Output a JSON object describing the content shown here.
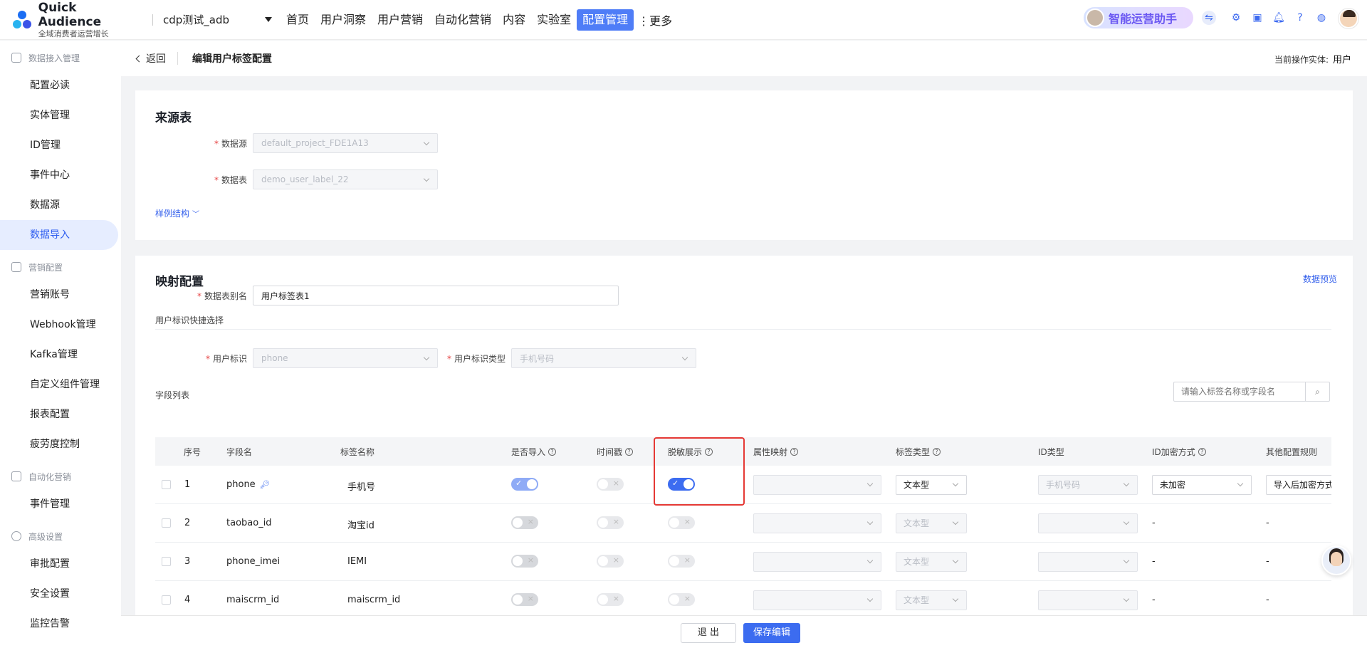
{
  "app": {
    "name": "Quick Audience",
    "slogan": "全域消费者运营增长",
    "project": "cdp测试_adb"
  },
  "nav": {
    "items": [
      "首页",
      "用户洞察",
      "用户营销",
      "自动化营销",
      "内容",
      "实验室",
      "配置管理"
    ],
    "active": "配置管理",
    "more": "更多"
  },
  "assistant": {
    "label": "智能运营助手"
  },
  "sidebar": {
    "groups": [
      {
        "title": "数据接入管理",
        "items": [
          "配置必读",
          "实体管理",
          "ID管理",
          "事件中心",
          "数据源",
          "数据导入"
        ]
      },
      {
        "title": "营销配置",
        "items": [
          "营销账号",
          "Webhook管理",
          "Kafka管理",
          "自定义组件管理",
          "报表配置",
          "疲劳度控制"
        ]
      },
      {
        "title": "自动化营销",
        "items": [
          "事件管理"
        ]
      },
      {
        "title": "高级设置",
        "items": [
          "审批配置",
          "安全设置",
          "监控告警"
        ]
      }
    ],
    "active": "数据导入"
  },
  "subhead": {
    "back": "返回",
    "title": "编辑用户标签配置",
    "entity_label": "当前操作实体:",
    "entity_value": "用户"
  },
  "source": {
    "title": "来源表",
    "datasource_label": "数据源",
    "datasource_value": "default_project_FDE1A13",
    "table_label": "数据表",
    "table_value": "demo_user_label_22",
    "sample_link": "样例结构"
  },
  "mapping": {
    "title": "映射配置",
    "preview_link": "数据预览",
    "alias_label": "数据表别名",
    "alias_value": "用户标签表1",
    "quick_title": "用户标识快捷选择",
    "uid_label": "用户标识",
    "uid_value": "phone",
    "uid_type_label": "用户标识类型",
    "uid_type_value": "手机号码",
    "field_list_title": "字段列表",
    "search_placeholder": "请输入标签名称或字段名"
  },
  "table": {
    "headers": {
      "index": "序号",
      "field": "字段名",
      "tag": "标签名称",
      "import": "是否导入",
      "timestamp": "时间戳",
      "mask": "脱敏展示",
      "attr": "属性映射",
      "tag_type": "标签类型",
      "id_type": "ID类型",
      "encrypt": "ID加密方式",
      "other": "其他配置规则"
    },
    "rows": [
      {
        "index": "1",
        "field": "phone",
        "tag": "手机号",
        "import": true,
        "timestamp": false,
        "mask": true,
        "tag_type": "文本型",
        "id_type": "手机号码",
        "encrypt": "未加密",
        "other": "导入后加密方式"
      },
      {
        "index": "2",
        "field": "taobao_id",
        "tag": "淘宝id",
        "import": false,
        "timestamp": false,
        "mask": false,
        "tag_type": "文本型",
        "id_type": "",
        "encrypt": "-",
        "other": "-"
      },
      {
        "index": "3",
        "field": "phone_imei",
        "tag": "IEMI",
        "import": false,
        "timestamp": false,
        "mask": false,
        "tag_type": "文本型",
        "id_type": "",
        "encrypt": "-",
        "other": "-"
      },
      {
        "index": "4",
        "field": "maiscrm_id",
        "tag": "maiscrm_id",
        "import": false,
        "timestamp": false,
        "mask": false,
        "tag_type": "文本型",
        "id_type": "",
        "encrypt": "-",
        "other": "-"
      }
    ]
  },
  "footer": {
    "exit": "退 出",
    "save": "保存编辑"
  },
  "colors": {
    "primary": "#3c6cf0",
    "highlight": "#e53935",
    "active_bg": "#e6edff"
  }
}
